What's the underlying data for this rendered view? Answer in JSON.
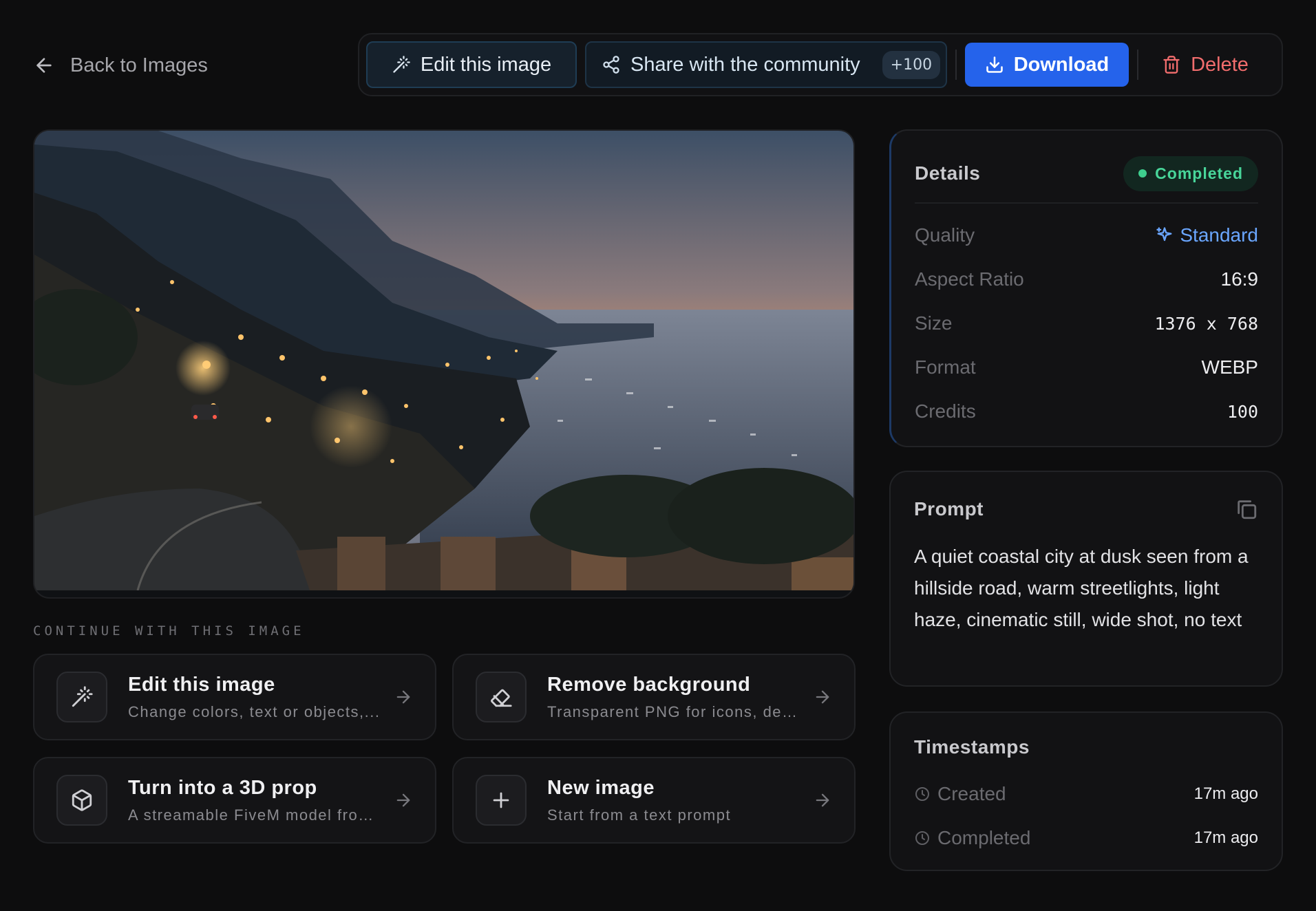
{
  "nav": {
    "back_label": "Back to Images"
  },
  "toolbar": {
    "edit_label": "Edit this image",
    "share_label": "Share with the community",
    "share_badge": "+100",
    "download_label": "Download",
    "delete_label": "Delete"
  },
  "continue": {
    "title": "CONTINUE WITH THIS IMAGE",
    "cards": [
      {
        "title": "Edit this image",
        "subtitle": "Change colors, text or objects,...",
        "icon": "magic-wand-icon"
      },
      {
        "title": "Remove background",
        "subtitle": "Transparent PNG for icons, dec...",
        "icon": "eraser-icon"
      },
      {
        "title": "Turn into a 3D prop",
        "subtitle": "A streamable FiveM model from ...",
        "icon": "cube-icon"
      },
      {
        "title": "New image",
        "subtitle": "Start from a text prompt",
        "icon": "plus-icon"
      }
    ]
  },
  "details": {
    "title": "Details",
    "status": "Completed",
    "rows": [
      {
        "label": "Quality",
        "value": "Standard"
      },
      {
        "label": "Aspect Ratio",
        "value": "16:9"
      },
      {
        "label": "Size",
        "value": "1376 x 768"
      },
      {
        "label": "Format",
        "value": "WEBP"
      },
      {
        "label": "Credits",
        "value": "100"
      }
    ]
  },
  "prompt": {
    "title": "Prompt",
    "text": "A quiet coastal city at dusk seen from a hillside road, warm streetlights, light haze, cinematic still, wide shot, no text"
  },
  "timestamps": {
    "title": "Timestamps",
    "rows": [
      {
        "label": "Created",
        "value": "17m ago"
      },
      {
        "label": "Completed",
        "value": "17m ago"
      }
    ]
  },
  "colors": {
    "accent": "#2563eb",
    "status_green": "#3ecf8e",
    "delete_red": "#f26d6d",
    "quality_blue": "#6aa6ff"
  }
}
